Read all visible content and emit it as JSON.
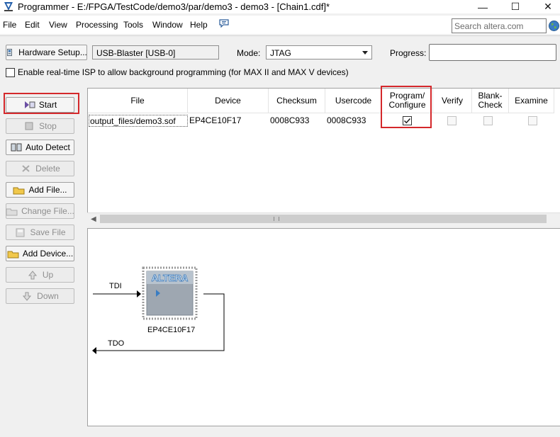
{
  "window": {
    "title": "Programmer - E:/FPGA/TestCode/demo3/par/demo3 - demo3 - [Chain1.cdf]*",
    "minimize_glyph": "—",
    "maximize_glyph": "☐",
    "close_glyph": "✕"
  },
  "menu": {
    "items": [
      "File",
      "Edit",
      "View",
      "Processing",
      "Tools",
      "Window",
      "Help"
    ],
    "search_placeholder": "Search altera.com"
  },
  "toolbar": {
    "hardware_setup_label": "Hardware Setup...",
    "hardware_value": "USB-Blaster [USB-0]",
    "mode_label": "Mode:",
    "mode_value": "JTAG",
    "progress_label": "Progress:",
    "progress_value": 0
  },
  "isp": {
    "checked": false,
    "label": "Enable real-time ISP to allow background programming (for MAX II and MAX V devices)"
  },
  "side_buttons": [
    {
      "label": "Start",
      "enabled": true,
      "icon": "start-icon",
      "highlighted": true
    },
    {
      "label": "Stop",
      "enabled": false,
      "icon": "stop-icon"
    },
    {
      "label": "Auto Detect",
      "enabled": true,
      "icon": "auto-detect-icon"
    },
    {
      "label": "Delete",
      "enabled": false,
      "icon": "delete-icon"
    },
    {
      "label": "Add File...",
      "enabled": true,
      "icon": "add-file-icon"
    },
    {
      "label": "Change File...",
      "enabled": false,
      "icon": "change-file-icon"
    },
    {
      "label": "Save File",
      "enabled": false,
      "icon": "save-file-icon"
    },
    {
      "label": "Add Device...",
      "enabled": true,
      "icon": "add-device-icon"
    },
    {
      "label": "Up",
      "enabled": false,
      "icon": "up-icon"
    },
    {
      "label": "Down",
      "enabled": false,
      "icon": "down-icon"
    }
  ],
  "table": {
    "columns": [
      "File",
      "Device",
      "Checksum",
      "Usercode",
      "Program/ Configure",
      "Verify",
      "Blank- Check",
      "Examine"
    ],
    "rows": [
      {
        "file": "output_files/demo3.sof",
        "device": "EP4CE10F17",
        "checksum": "0008C933",
        "usercode": "0008C933",
        "program_configure": true,
        "verify": false,
        "blank_check": false,
        "examine": false
      }
    ]
  },
  "chain": {
    "tdi_label": "TDI",
    "tdo_label": "TDO",
    "device_name": "EP4CE10F17",
    "chip_logo": "ALTERA"
  },
  "colors": {
    "highlight": "#d4282b",
    "chip_body": "#9aa3ad",
    "logo_blue": "#2a6fb5"
  }
}
